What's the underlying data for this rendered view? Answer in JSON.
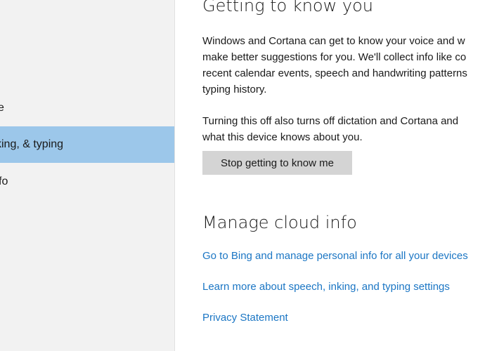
{
  "sidebar": {
    "items": [
      {
        "label": "e"
      },
      {
        "label": "king, & typing",
        "selected": true
      },
      {
        "label": "fo"
      }
    ]
  },
  "main": {
    "section1": {
      "heading": "Getting to know you",
      "paragraph1": [
        "Windows and Cortana can get to know your voice and w",
        "make better suggestions for you. We'll collect info like co",
        "recent calendar events, speech and handwriting patterns",
        "typing history."
      ],
      "paragraph2": [
        "Turning this off also turns off dictation and Cortana and",
        "what this device knows about you."
      ],
      "button_label": "Stop getting to know me"
    },
    "section2": {
      "heading": "Manage cloud info",
      "links": [
        "Go to Bing and manage personal info for all your devices",
        "Learn more about speech, inking, and typing settings",
        "Privacy Statement"
      ]
    }
  },
  "colors": {
    "sidebar_bg": "#f2f2f2",
    "selected_bg": "#9cc7ea",
    "link": "#1b76c4",
    "button_bg": "#d4d4d4",
    "text": "#1a1a1a"
  }
}
